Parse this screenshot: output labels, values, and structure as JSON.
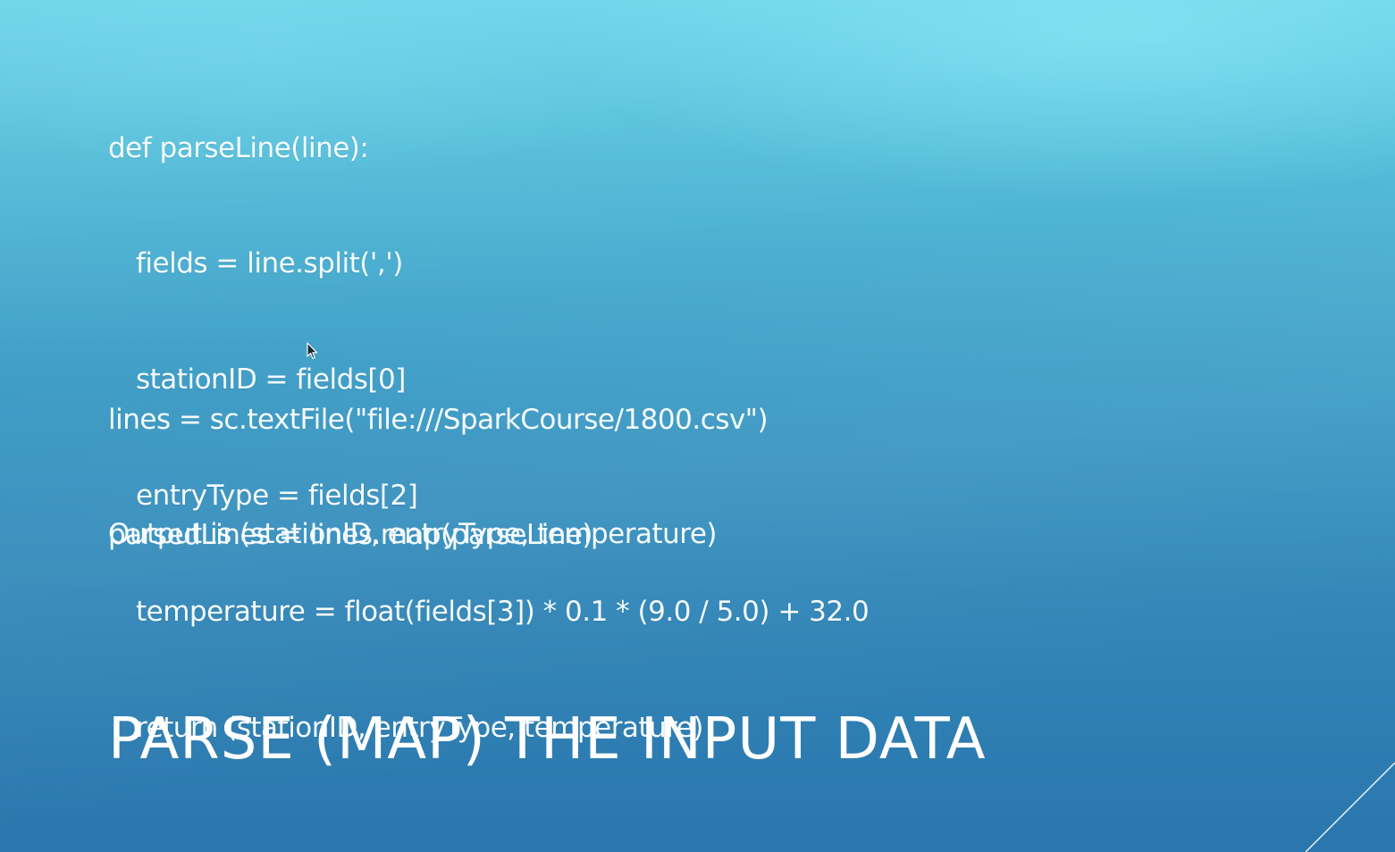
{
  "slide": {
    "code_function": [
      "def parseLine(line):",
      "fields = line.split(',')",
      "stationID = fields[0]",
      "entryType = fields[2]",
      "temperature = float(fields[3]) * 0.1 * (9.0 / 5.0) + 32.0",
      "return (stationID, entryType, temperature)"
    ],
    "code_load": [
      "lines = sc.textFile(\"file:///SparkCourse/1800.csv\")",
      "parsedLines = lines.map(parseLine)"
    ],
    "output_note": "Output is (stationID, entryType, temperature)",
    "title": "PARSE (MAP) THE INPUT DATA"
  },
  "colors": {
    "background_top": "#69d4e8",
    "background_bottom": "#2a76ad",
    "text": "#ffffff"
  },
  "icons": {
    "cursor": "mouse-pointer-icon"
  }
}
